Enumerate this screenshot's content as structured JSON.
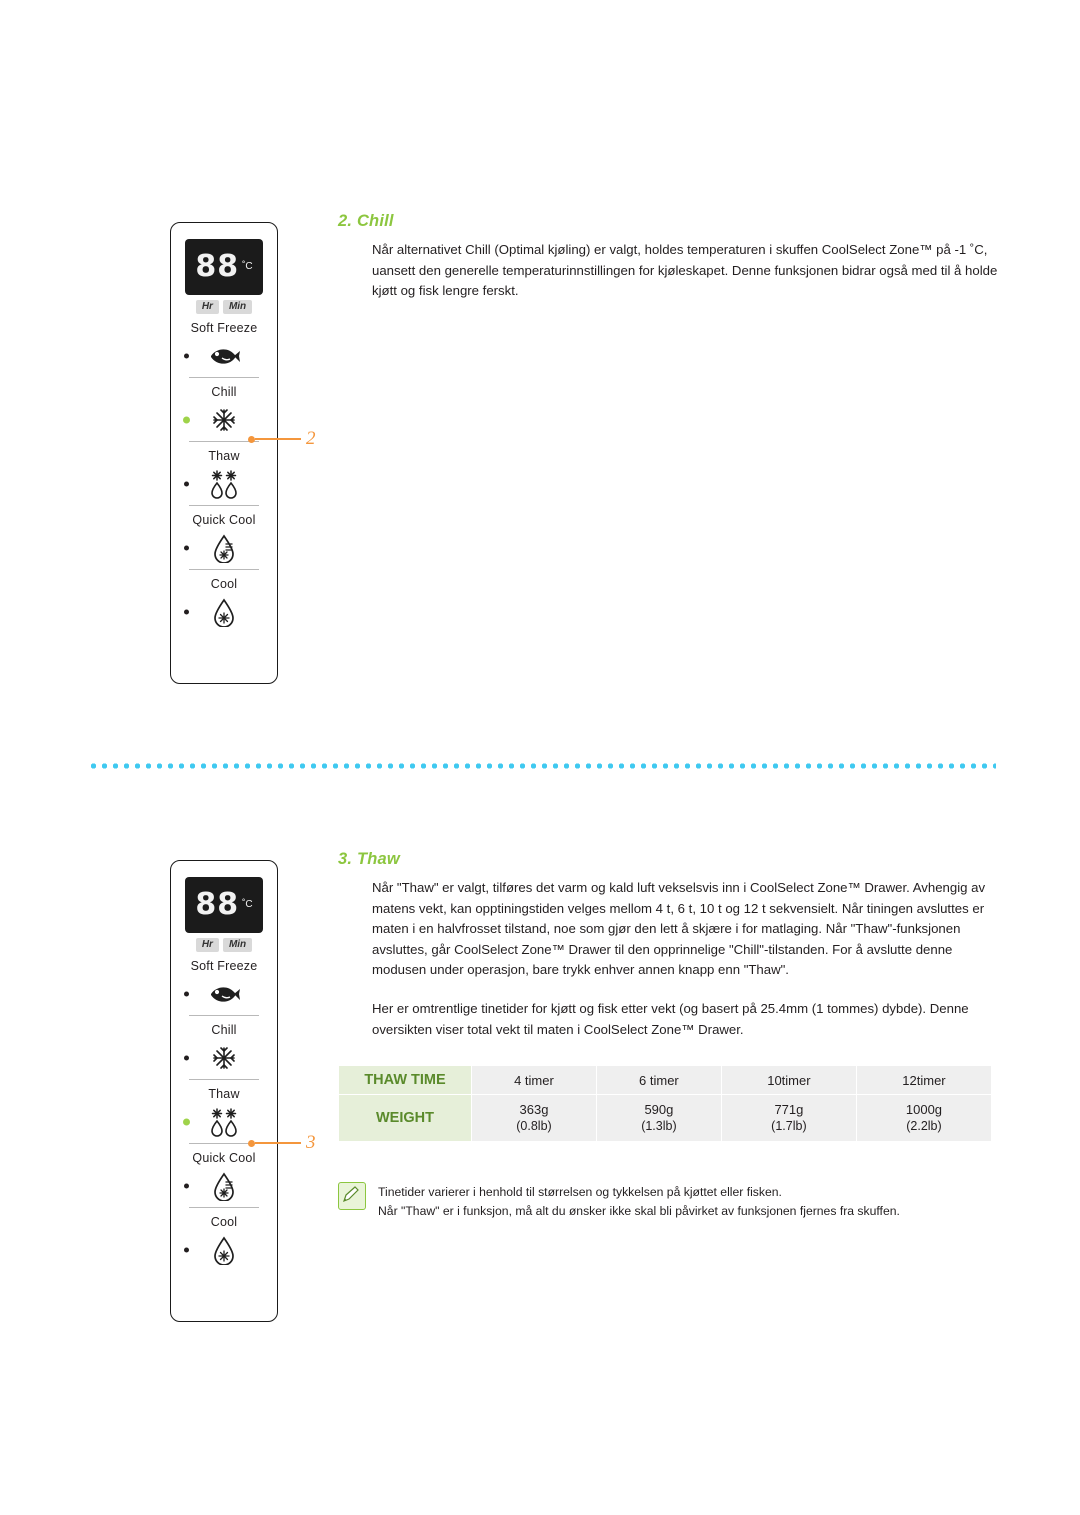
{
  "sections": [
    {
      "number_label": "2. Chill",
      "callout_number": "2",
      "body": "Når alternativet Chill (Optimal kjøling) er valgt, holdes temperaturen i skuffen CoolSelect Zone™ på -1 ˚C, uansett den generelle temperaturinnstillingen for kjøleskapet. Denne funksjonen bidrar også med til å holde kjøtt og fisk lengre ferskt."
    },
    {
      "number_label": "3. Thaw",
      "callout_number": "3",
      "body": "Når \"Thaw\" er valgt, tilføres det varm og kald luft vekselsvis inn i CoolSelect Zone™ Drawer. Avhengig av matens vekt, kan opptiningstiden velges mellom 4 t, 6 t, 10 t og 12 t sekvensielt. Når tiningen avsluttes er maten i en halvfrosset tilstand, noe som gjør den lett å skjære i for matlaging. Når \"Thaw\"-funksjonen avsluttes, går CoolSelect Zone™ Drawer til den opprinnelige \"Chill\"-tilstanden. For å avslutte denne modusen under operasjon, bare trykk enhver annen knapp enn \"Thaw\".",
      "body2": "Her er omtrentlige tinetider for kjøtt og fisk etter vekt (og basert på 25.4mm (1 tommes) dybde). Denne oversikten viser total vekt til maten i CoolSelect Zone™ Drawer."
    }
  ],
  "panel": {
    "display_value": "88",
    "display_unit": "˚C",
    "hr_label": "Hr",
    "min_label": "Min",
    "rows": [
      {
        "label": "Soft Freeze",
        "icon": "fish-icon",
        "active": false
      },
      {
        "label": "Chill",
        "icon": "snowflake-icon",
        "active": false
      },
      {
        "label": "Thaw",
        "icon": "thaw-drops-icon",
        "active": false
      },
      {
        "label": "Quick Cool",
        "icon": "quick-cool-drop-icon",
        "active": false
      },
      {
        "label": "Cool",
        "icon": "cool-drop-icon",
        "active": false
      }
    ],
    "active_row_panel1": 1,
    "active_row_panel2": 2
  },
  "table": {
    "row1_header": "THAW TIME",
    "row2_header": "WEIGHT",
    "times": [
      "4 timer",
      "6 timer",
      "10timer",
      "12timer"
    ],
    "weights_g": [
      "363g",
      "590g",
      "771g",
      "1000g"
    ],
    "weights_lb": [
      "(0.8lb)",
      "(1.3lb)",
      "(1.7lb)",
      "(2.2lb)"
    ]
  },
  "note": {
    "line1": "Tinetider varierer i henhold til størrelsen og tykkelsen på kjøttet eller fisken.",
    "line2": "Når \"Thaw\" er i funksjon, må alt du ønsker ikke skal bli påvirket av funksjonen fjernes fra skuffen."
  },
  "colors": {
    "accent_green": "#8cc63f",
    "accent_orange": "#f4963c",
    "dotted_blue": "#3fc9f0"
  }
}
